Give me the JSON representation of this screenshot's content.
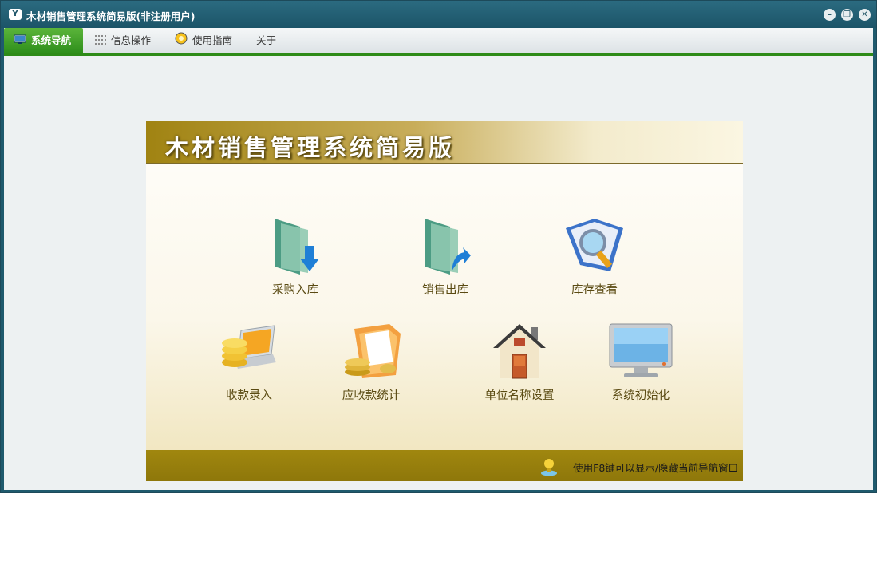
{
  "window": {
    "title": "木材销售管理系统简易版(非注册用户)",
    "icon": "app-logo-icon"
  },
  "menu": {
    "items": [
      {
        "label": "系统导航",
        "icon": "monitor-icon",
        "active": true
      },
      {
        "label": "信息操作",
        "icon": "grid-icon",
        "active": false
      },
      {
        "label": "使用指南",
        "icon": "guide-icon",
        "active": false
      },
      {
        "label": "关于",
        "icon": "",
        "active": false
      }
    ]
  },
  "panel": {
    "banner_title": "木材销售管理系统简易版",
    "buttons": [
      {
        "label": "采购入库",
        "icon": "folder-in-icon"
      },
      {
        "label": "销售出库",
        "icon": "folder-out-icon"
      },
      {
        "label": "库存查看",
        "icon": "magnifier-book-icon"
      },
      {
        "label": "收款录入",
        "icon": "coins-laptop-icon"
      },
      {
        "label": "应收款统计",
        "icon": "coins-folder-icon"
      },
      {
        "label": "单位名称设置",
        "icon": "house-icon"
      },
      {
        "label": "系统初始化",
        "icon": "monitor-screen-icon"
      }
    ],
    "footer_hint": "使用F8键可以显示/隐藏当前导航窗口"
  },
  "colors": {
    "titlebar": "#1f5a6d",
    "active_menu": "#3a9a24",
    "banner_gold": "#a08312",
    "label_text": "#5a4a12"
  }
}
